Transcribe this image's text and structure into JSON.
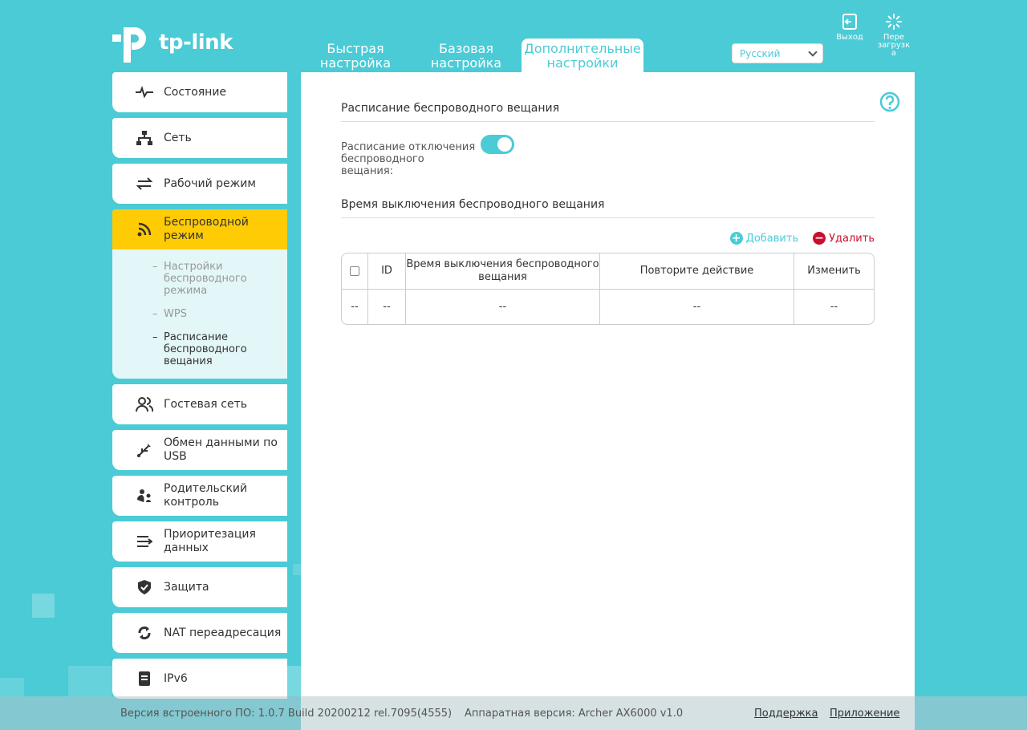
{
  "header": {
    "logo_text": "tp-link",
    "tabs": [
      {
        "label": "Быстрая настройка"
      },
      {
        "label": "Базовая настройка"
      },
      {
        "label": "Дополнительные настройки"
      }
    ],
    "language": "Русский",
    "logout_label": "Выход",
    "reboot_label": "Пере загрузк а"
  },
  "sidebar": {
    "items": [
      {
        "label": "Состояние",
        "icon": "status-icon"
      },
      {
        "label": "Сеть",
        "icon": "network-icon"
      },
      {
        "label": "Рабочий режим",
        "icon": "mode-icon"
      },
      {
        "label": "Беспроводной режим",
        "icon": "wireless-icon"
      },
      {
        "label": "Гостевая сеть",
        "icon": "guest-icon"
      },
      {
        "label": "Обмен данными по USB",
        "icon": "usb-icon"
      },
      {
        "label": "Родительский контроль",
        "icon": "parental-icon"
      },
      {
        "label": "Приоритезация данных",
        "icon": "qos-icon"
      },
      {
        "label": "Защита",
        "icon": "shield-icon"
      },
      {
        "label": "NAT переадресация",
        "icon": "nat-icon"
      },
      {
        "label": "IPv6",
        "icon": "ipv6-icon"
      }
    ],
    "wireless_sub": [
      {
        "label": "Настройки беспроводного режима"
      },
      {
        "label": "WPS"
      },
      {
        "label": "Расписание беспроводного вещания"
      }
    ],
    "active_index": 3
  },
  "main": {
    "section1_title": "Расписание беспроводного вещания",
    "toggle_label": "Расписание отключения беспроводного вещания:",
    "toggle_on": true,
    "section2_title": "Время выключения беспроводного вещания",
    "add_label": "Добавить",
    "delete_label": "Удалить",
    "table": {
      "headers": [
        "ID",
        "Время выключения беспроводного вещания",
        "Повторите действие",
        "Изменить"
      ],
      "rows": [
        [
          "--",
          "--",
          "--",
          "--",
          "--"
        ]
      ]
    }
  },
  "footer": {
    "firmware": "Версия встроенного ПО: 1.0.7 Build 20200212 rel.7095(4555)",
    "hardware": "Аппаратная версия: Archer AX6000 v1.0",
    "support": "Поддержка",
    "app": "Приложение"
  },
  "colors": {
    "accent": "#4acbd6",
    "active": "#ffcb05",
    "danger": "#c8102e"
  }
}
